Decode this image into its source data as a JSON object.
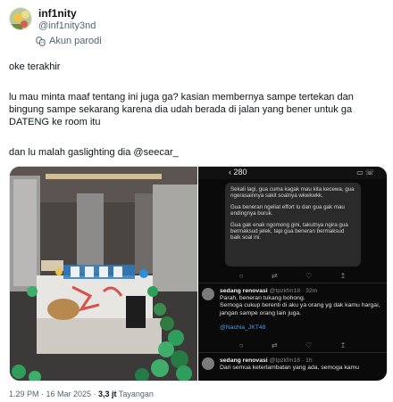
{
  "author": {
    "display_name": "inf1nity",
    "handle": "@inf1nity3nd",
    "parody_label": "Akun parodi"
  },
  "tweet": {
    "lines": [
      "oke terakhir",
      "lu mau minta maaf tentang ini juga ga? kasian membernya sampe tertekan dan bingung sampe sekarang karena dia udah berada di jalan yang bener untuk ga DATENG ke room itu",
      "dan lu malah gaslighting dia @seecar_"
    ]
  },
  "media": {
    "phone": {
      "back_count": "280",
      "dm_messages": [
        "Sekali lagi, gua cuma kagak mau kita kecewa, gua ngerasainnya sakit soalnya wkwkwkk.",
        "Gua beneran ngeliat effort lu dan gua gak mau endingnya buruk.",
        "Gua gak enak ngomong gini, takutnya ngira gua bermaksud jelek, tapi gua beneran bermaksud baik soal ini."
      ],
      "reply1": {
        "name": "sedang renovasi",
        "handle": "@tpzkfm18 · 32m",
        "text": "Parah, beneran tukang bohong.",
        "text2": "Semoga cukup berenti di aku ya orang yg dak kamu hargai, jangan sampe orang lain juga.",
        "mention": "@Nachia_JKT48"
      },
      "reply2": {
        "name": "sedang renovasi",
        "handle": "@tpzkfm18 · 1h",
        "text": "Dari semua keterlambatan yang ada, semoga kamu"
      }
    }
  },
  "footer": {
    "time": "1.29 PM · 16 Mar 2025 · ",
    "views_count": "3,3 jt",
    "views_label": "Tayangan"
  }
}
